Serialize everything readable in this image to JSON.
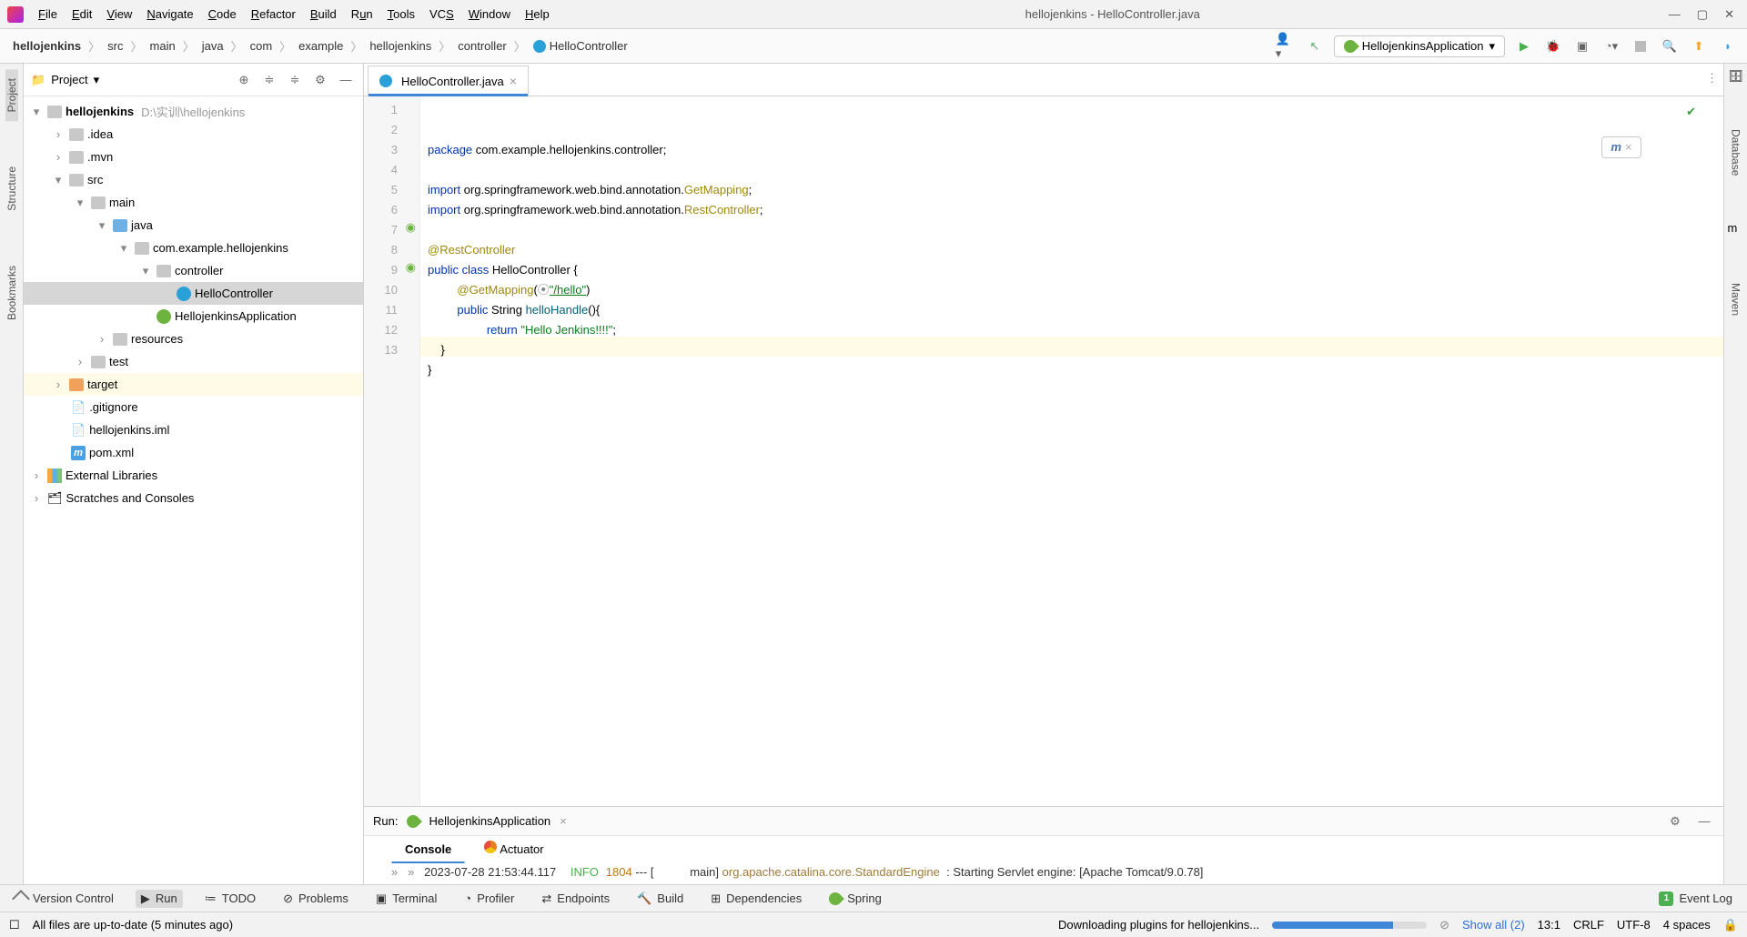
{
  "window_title": "hellojenkins - HelloController.java",
  "menu": [
    "File",
    "Edit",
    "View",
    "Navigate",
    "Code",
    "Refactor",
    "Build",
    "Run",
    "Tools",
    "VCS",
    "Window",
    "Help"
  ],
  "breadcrumb": [
    "hellojenkins",
    "src",
    "main",
    "java",
    "com",
    "example",
    "hellojenkins",
    "controller",
    "HelloController"
  ],
  "run_config": "HellojenkinsApplication",
  "left_labels": [
    "Project",
    "Structure",
    "Bookmarks"
  ],
  "right_labels": [
    "Database",
    "Maven"
  ],
  "project_title": "Project",
  "tree": {
    "root": "hellojenkins",
    "root_path": "D:\\实训\\hellojenkins",
    "items": {
      "idea": ".idea",
      "mvn": ".mvn",
      "src": "src",
      "main": "main",
      "java": "java",
      "pkg": "com.example.hellojenkins",
      "controller": "controller",
      "helloController": "HelloController",
      "app": "HellojenkinsApplication",
      "resources": "resources",
      "test": "test",
      "target": "target",
      "gitignore": ".gitignore",
      "iml": "hellojenkins.iml",
      "pom": "pom.xml",
      "ext": "External Libraries",
      "scratches": "Scratches and Consoles"
    }
  },
  "tab": "HelloController.java",
  "code": {
    "l1_kw": "package",
    "l1_rest": " com.example.hellojenkins.controller;",
    "l3_kw": "import",
    "l3_mid": " org.springframework.web.bind.annotation.",
    "l3_cls": "GetMapping",
    "l3_end": ";",
    "l4_kw": "import",
    "l4_mid": " org.springframework.web.bind.annotation.",
    "l4_cls": "RestController",
    "l4_end": ";",
    "l6": "@RestController",
    "l7_pub": "public ",
    "l7_cls": "class ",
    "l7_name": "HelloController",
    " l7_br": " {",
    "l8_ann": "@GetMapping",
    "l8_open": "(",
    "l8_icon": "⦿",
    "l8_str": "\"/hello\"",
    "l8_close": ")",
    "l9_pub": "public ",
    "l9_type": "String ",
    "l9_fn": "helloHandle",
    "l9_rest": "(){",
    "l10_ret": "return ",
    "l10_str": "\"Hello Jenkins!!!!\"",
    "l10_end": ";",
    "l11": "    }",
    "l12": "}"
  },
  "run": {
    "label": "Run:",
    "app": "HellojenkinsApplication",
    "tabs": [
      "Console",
      "Actuator"
    ],
    "log_time": "2023-07-28 21:53:44.117",
    "log_level": "INFO",
    "log_pid": "1804",
    "log_mid": " --- [           main] ",
    "log_class": "org.apache.catalina.core.StandardEngine",
    "log_msg": "  : Starting Servlet engine: [Apache Tomcat/9.0.78]"
  },
  "tool_strip": [
    "Version Control",
    "Run",
    "TODO",
    "Problems",
    "Terminal",
    "Profiler",
    "Endpoints",
    "Build",
    "Dependencies",
    "Spring"
  ],
  "event_log": "Event Log",
  "status": {
    "vcs": "All files are up-to-date (5 minutes ago)",
    "download": "Downloading plugins for hellojenkins...",
    "show_all": "Show all (2)",
    "pos": "13:1",
    "sep": "CRLF",
    "enc": "UTF-8",
    "indent": "4 spaces"
  }
}
